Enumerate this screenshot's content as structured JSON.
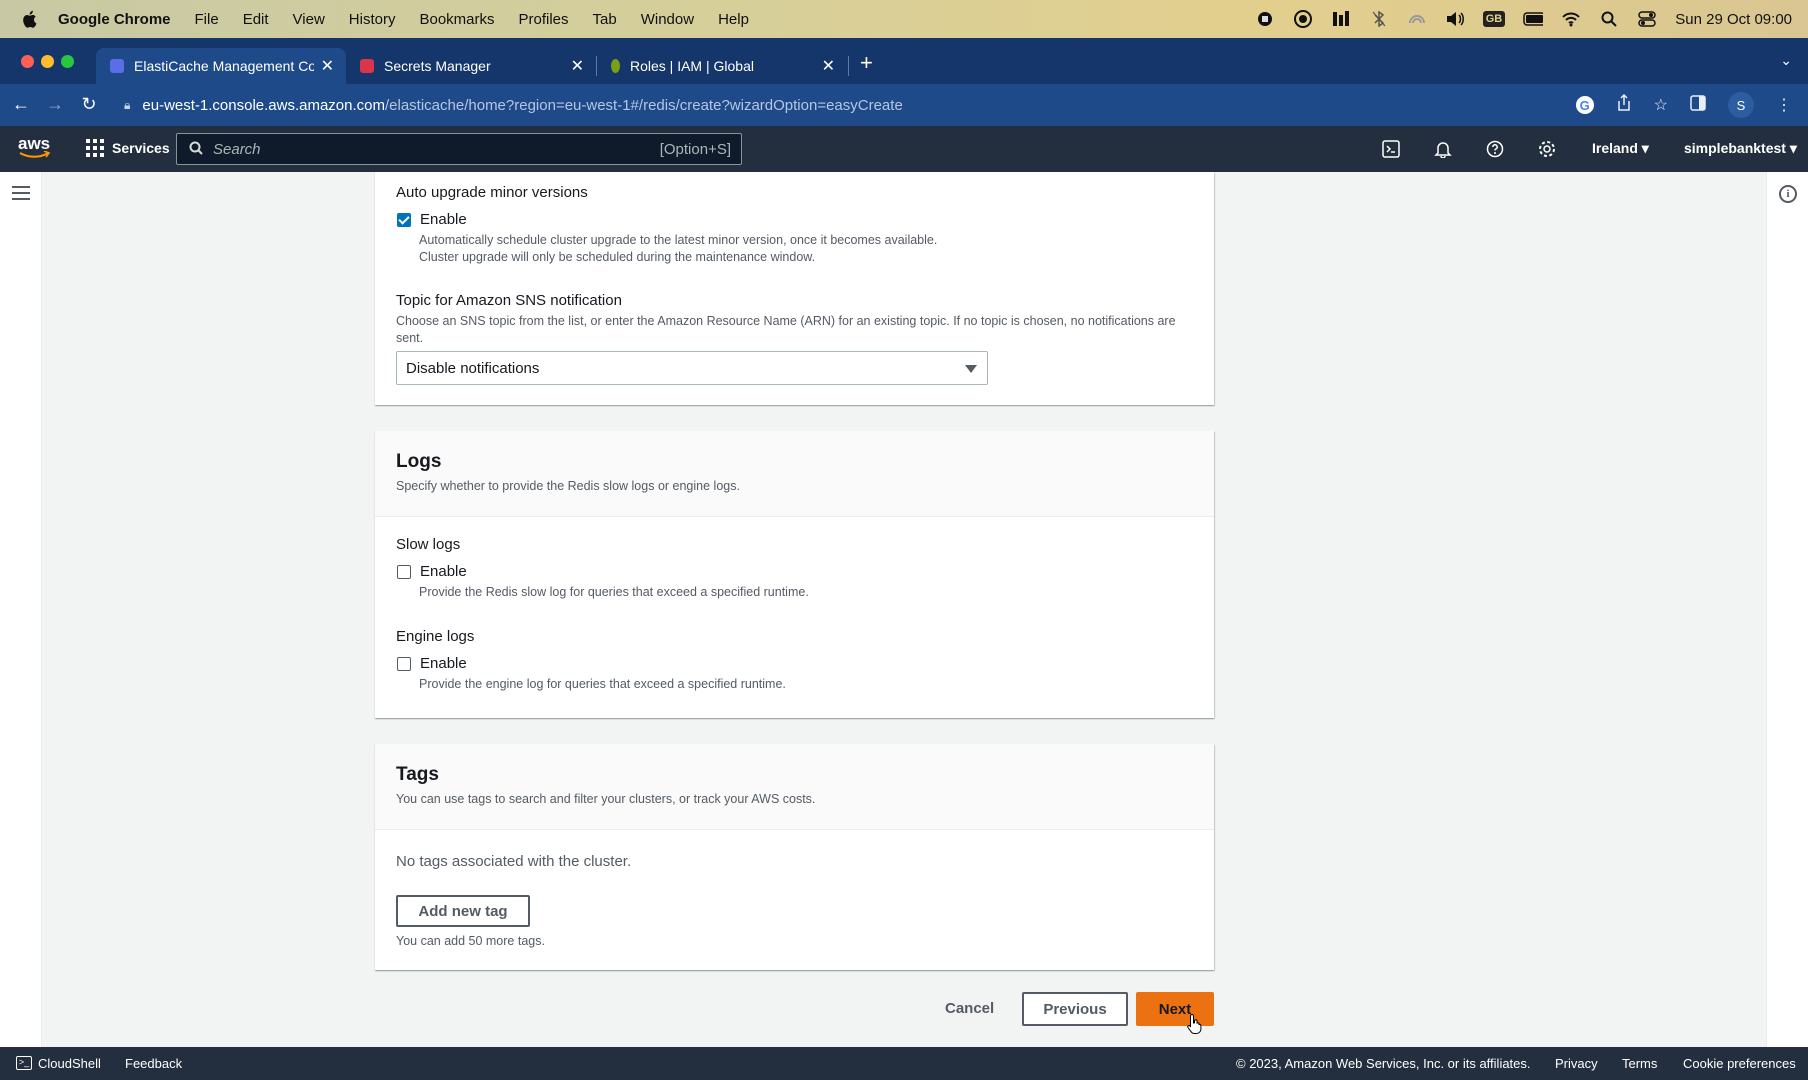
{
  "mac_menu": {
    "app_name": "Google Chrome",
    "items": [
      "File",
      "Edit",
      "View",
      "History",
      "Bookmarks",
      "Profiles",
      "Tab",
      "Window",
      "Help"
    ],
    "status": {
      "keyboard": "GB",
      "datetime": "Sun 29 Oct  09:00"
    }
  },
  "browser": {
    "tabs": [
      {
        "title": "ElastiCache Management Con",
        "active": true,
        "favicon_color": "#5a6ee8"
      },
      {
        "title": "Secrets Manager",
        "active": false,
        "favicon_color": "#dd344c"
      },
      {
        "title": "Roles | IAM | Global",
        "active": false,
        "favicon_color": "#7aa116"
      }
    ],
    "url_host": "eu-west-1.console.aws.amazon.com",
    "url_path": "/elasticache/home?region=eu-west-1#/redis/create?wizardOption=easyCreate",
    "profile_initial": "S"
  },
  "aws_nav": {
    "logo": "aws",
    "services_label": "Services",
    "search_placeholder": "Search",
    "search_shortcut": "[Option+S]",
    "region": "Ireland",
    "account": "simplebanktest"
  },
  "maintenance": {
    "auto_upgrade": {
      "label": "Auto upgrade minor versions",
      "checkbox_label": "Enable",
      "checked": true,
      "desc_line1": "Automatically schedule cluster upgrade to the latest minor version, once it becomes available.",
      "desc_line2": "Cluster upgrade will only be scheduled during the maintenance window."
    },
    "sns": {
      "label": "Topic for Amazon SNS notification",
      "desc_line1": "Choose an SNS topic from the list, or enter the Amazon Resource Name (ARN) for an existing topic. If no topic is chosen, no notifications are",
      "desc_line2": "sent.",
      "selected": "Disable notifications"
    }
  },
  "logs": {
    "title": "Logs",
    "desc": "Specify whether to provide the Redis slow logs or engine logs.",
    "slow": {
      "label": "Slow logs",
      "checkbox_label": "Enable",
      "checked": false,
      "desc": "Provide the Redis slow log for queries that exceed a specified runtime."
    },
    "engine": {
      "label": "Engine logs",
      "checkbox_label": "Enable",
      "checked": false,
      "desc": "Provide the engine log for queries that exceed a specified runtime."
    }
  },
  "tags": {
    "title": "Tags",
    "desc": "You can use tags to search and filter your clusters, or track your AWS costs.",
    "empty": "No tags associated with the cluster.",
    "add_label": "Add new tag",
    "limit_note": "You can add 50 more tags."
  },
  "actions": {
    "cancel": "Cancel",
    "previous": "Previous",
    "next": "Next"
  },
  "footer": {
    "cloudshell": "CloudShell",
    "feedback": "Feedback",
    "copyright": "© 2023, Amazon Web Services, Inc. or its affiliates.",
    "privacy": "Privacy",
    "terms": "Terms",
    "cookies": "Cookie preferences"
  },
  "colors": {
    "primary_button": "#ec7211",
    "checkbox_on": "#0073bb",
    "aws_nav_bg": "#232f3e",
    "chrome_tab_bg": "#15366a"
  }
}
